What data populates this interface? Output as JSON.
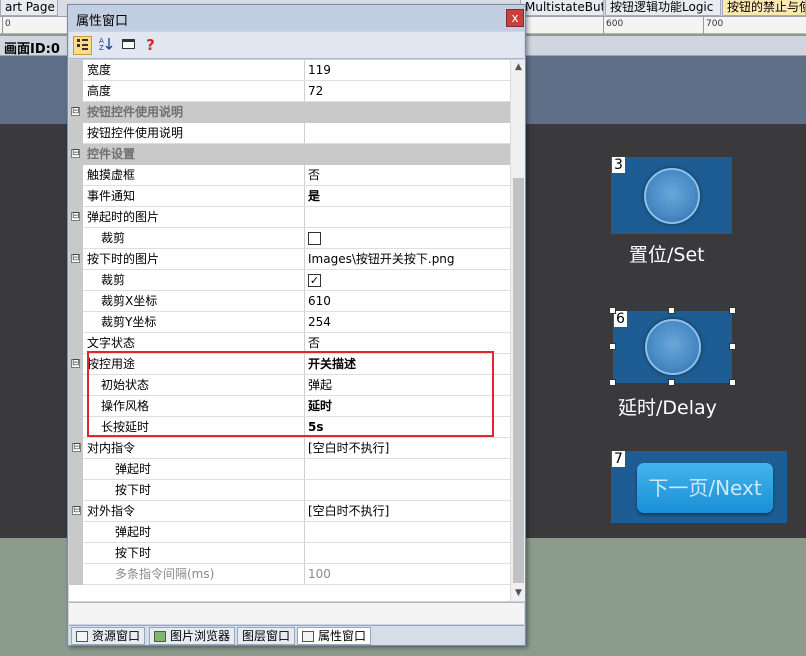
{
  "editor_tabs": [
    {
      "label": "art Page"
    },
    {
      "label": "MultistateButton"
    },
    {
      "label": "按钮逻辑功能Logic"
    },
    {
      "label": "按钮的禁止与使能"
    }
  ],
  "ruler": {
    "label_0": "0",
    "label_600": "600",
    "label_700": "700"
  },
  "canvas": {
    "header": "画面ID:0",
    "widgets": [
      {
        "id": "3",
        "caption": "置位/Set"
      },
      {
        "id": "6",
        "caption": "延时/Delay"
      },
      {
        "id": "7",
        "caption": "下一页/Next"
      }
    ]
  },
  "property_window": {
    "title": "属性窗口",
    "close": "x",
    "toolbar": {
      "help": "?"
    },
    "rows": [
      {
        "name": "宽度",
        "value": "119"
      },
      {
        "name": "高度",
        "value": "72"
      },
      {
        "name": "按钮控件使用说明",
        "toggle": "⊟"
      },
      {
        "name": "按钮控件使用说明",
        "value": ""
      },
      {
        "name": "控件设置",
        "toggle": "⊟"
      },
      {
        "name": "触摸虚框",
        "value": "否"
      },
      {
        "name": "事件通知",
        "value": "是"
      },
      {
        "name": "弹起时的图片",
        "value": "",
        "toggle": "⊟"
      },
      {
        "name": "裁剪",
        "value": ""
      },
      {
        "name": "按下时的图片",
        "value": "Images\\按钮开关按下.png",
        "toggle": "⊟"
      },
      {
        "name": "裁剪",
        "value": "✓"
      },
      {
        "name": "裁剪X坐标",
        "value": "610"
      },
      {
        "name": "裁剪Y坐标",
        "value": "254"
      },
      {
        "name": "文字状态",
        "value": "否"
      },
      {
        "name": "按控用途",
        "value": "开关描述",
        "toggle": "⊟"
      },
      {
        "name": "初始状态",
        "value": "弹起"
      },
      {
        "name": "操作风格",
        "value": "延时"
      },
      {
        "name": "长按延时",
        "value": "5s"
      },
      {
        "name": "对内指令",
        "value": "[空白时不执行]",
        "toggle": "⊟"
      },
      {
        "name": "弹起时",
        "value": ""
      },
      {
        "name": "按下时",
        "value": ""
      },
      {
        "name": "对外指令",
        "value": "[空白时不执行]",
        "toggle": "⊟"
      },
      {
        "name": "弹起时",
        "value": ""
      },
      {
        "name": "按下时",
        "value": ""
      },
      {
        "name": "多条指令间隔(ms)",
        "value": "100"
      }
    ],
    "scroll": {
      "up": "▲",
      "down": "▼"
    },
    "bottom_tabs": [
      {
        "label": "资源窗口"
      },
      {
        "label": "图片浏览器"
      },
      {
        "label": "图层窗口"
      },
      {
        "label": "属性窗口"
      }
    ]
  },
  "colors": {
    "highlight": "#e0272b",
    "widget_bg": "#1d5d93",
    "canvas_bg": "#3a3a3c"
  }
}
